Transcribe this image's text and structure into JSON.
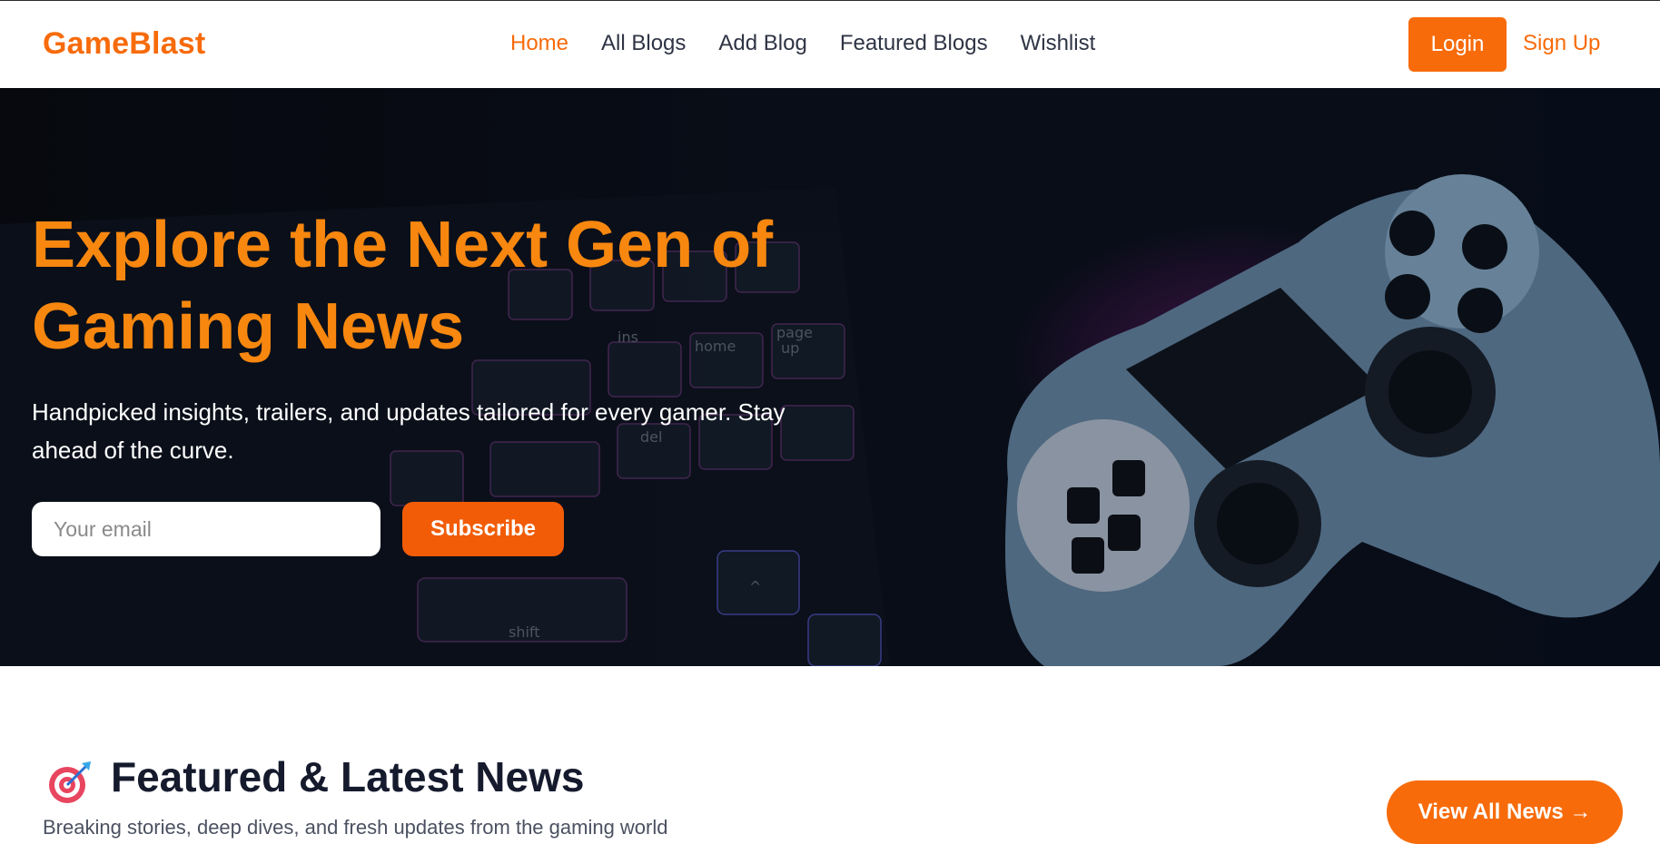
{
  "nav": {
    "logo": "GameBlast",
    "links": [
      {
        "label": "Home",
        "active": true
      },
      {
        "label": "All Blogs"
      },
      {
        "label": "Add Blog"
      },
      {
        "label": "Featured Blogs"
      },
      {
        "label": "Wishlist"
      }
    ],
    "login_label": "Login",
    "signup_label": "Sign Up"
  },
  "hero": {
    "title_line1": "Explore the Next Gen of",
    "title_line2": "Gaming News",
    "subtitle_line1": "Handpicked insights, trailers, and updates tailored for every gamer. Stay",
    "subtitle_line2": "ahead of the curve.",
    "email_placeholder": "Your email",
    "subscribe_label": "Subscribe"
  },
  "featured": {
    "icon": "target-icon",
    "title": "Featured & Latest News",
    "subtitle": "Breaking stories, deep dives, and fresh updates from the gaming world",
    "view_all_label": "View All News →"
  },
  "colors": {
    "accent": "#f76b0b",
    "hero_title": "#f7870f",
    "subscribe": "#f25c07",
    "heading_dark": "#151a2d"
  }
}
